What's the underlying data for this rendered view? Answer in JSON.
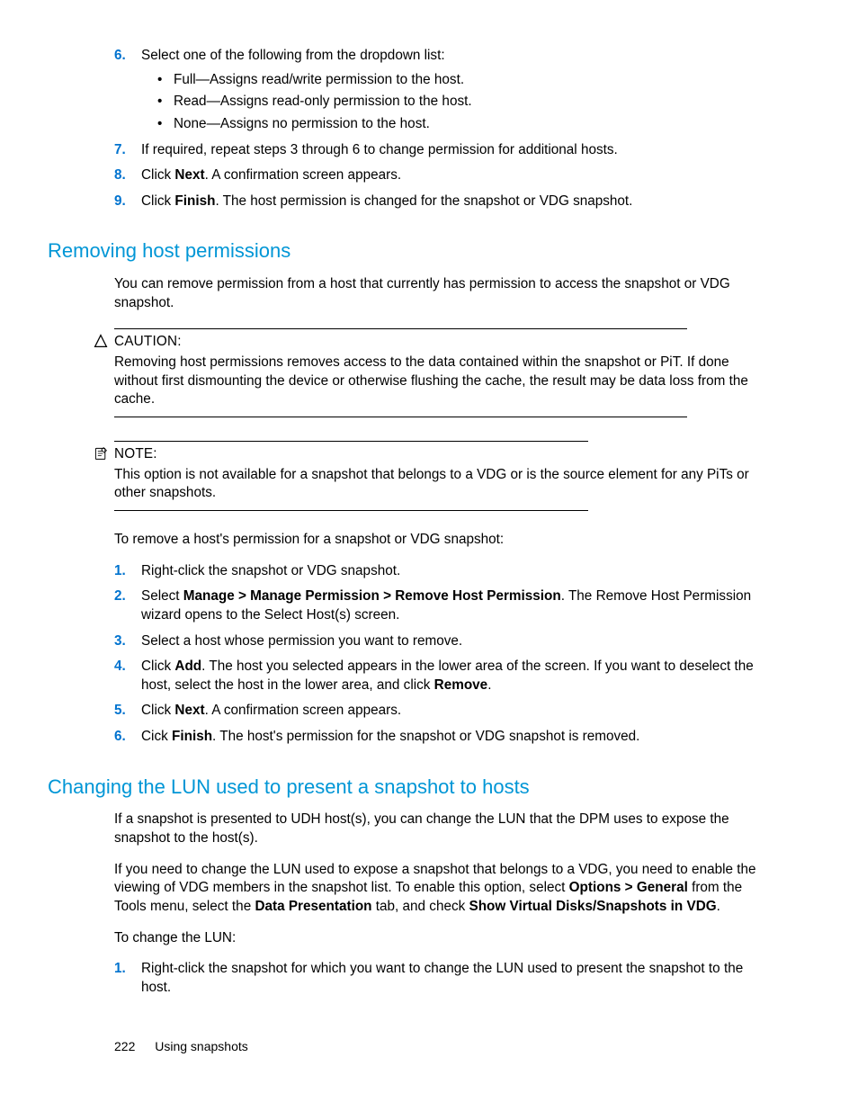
{
  "topList": {
    "step6": "Select one of the following from the dropdown list:",
    "bullets": [
      "Full—Assigns read/write permission to the host.",
      "Read—Assigns read-only permission to the host.",
      "None—Assigns no permission to the host."
    ],
    "step7": "If required, repeat steps 3 through 6 to change permission for additional hosts.",
    "step8_pre": "Click ",
    "step8_bold": "Next",
    "step8_post": ". A confirmation screen appears.",
    "step9_pre": "Click ",
    "step9_bold": "Finish",
    "step9_post": ". The host permission is changed for the snapshot or VDG snapshot."
  },
  "section1": {
    "heading": "Removing host permissions",
    "intro": "You can remove permission from a host that currently has permission to access the snapshot or VDG snapshot.",
    "caution_label": "CAUTION:",
    "caution_body": "Removing host permissions removes access to the data contained within the snapshot or PiT. If done without first dismounting the device or otherwise flushing the cache, the result may be data loss from the cache.",
    "note_label": "NOTE:",
    "note_body": "This option is not available for a snapshot that belongs to a VDG or is the source element for any PiTs or other snapshots.",
    "lead": "To remove a host's permission for a snapshot or VDG snapshot:",
    "step1": "Right-click the snapshot or VDG snapshot.",
    "step2_pre": "Select ",
    "step2_bold": "Manage > Manage Permission > Remove Host Permission",
    "step2_post": ". The Remove Host Permission wizard opens to the Select Host(s) screen.",
    "step3": "Select a host whose permission you want to remove.",
    "step4_pre": "Click ",
    "step4_b1": "Add",
    "step4_mid": ". The host you selected appears in the lower area of the screen. If you want to deselect the host, select the host in the lower area, and click ",
    "step4_b2": "Remove",
    "step4_post": ".",
    "step5_pre": "Click ",
    "step5_bold": "Next",
    "step5_post": ". A confirmation screen appears.",
    "step6_pre": "Cick ",
    "step6_bold": "Finish",
    "step6_post": ". The host's permission for the snapshot or VDG snapshot is removed."
  },
  "section2": {
    "heading": "Changing the LUN used to present a snapshot to hosts",
    "p1": "If a snapshot is presented to UDH host(s), you can change the LUN that the DPM uses to expose the snapshot to the host(s).",
    "p2_pre": "If you need to change the LUN used to expose a snapshot that belongs to a VDG, you need to enable the viewing of VDG members in the snapshot list. To enable this option, select ",
    "p2_b1": "Options > General",
    "p2_mid1": " from the Tools menu, select the ",
    "p2_b2": "Data Presentation",
    "p2_mid2": " tab, and check ",
    "p2_b3": "Show Virtual Disks/Snapshots in VDG",
    "p2_post": ".",
    "lead": "To change the LUN:",
    "step1": "Right-click the snapshot for which you want to change the LUN used to present the snapshot to the host."
  },
  "footer": {
    "pageNumber": "222",
    "chapter": "Using snapshots"
  },
  "numbers": {
    "n1": "1.",
    "n2": "2.",
    "n3": "3.",
    "n4": "4.",
    "n5": "5.",
    "n6": "6.",
    "n7": "7.",
    "n8": "8.",
    "n9": "9."
  }
}
